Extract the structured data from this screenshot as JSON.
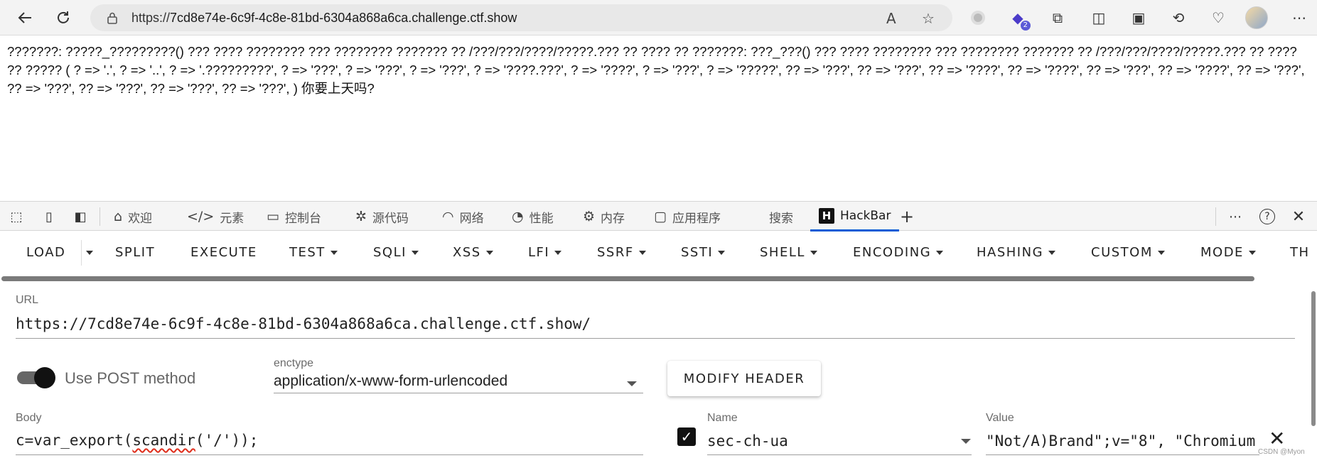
{
  "browser": {
    "url_prefix": "https://",
    "url_host": "7cd8e74e-6c9f-4c8e-81bd-6304a868a6ca.challenge.ctf.show",
    "extension_badge": "2"
  },
  "page": {
    "text": "???????: ?????_?????????() ??? ???? ???????? ??? ???????? ??????? ?? /???/???/????/?????.??? ?? ???? ?? ???????: ???_???() ??? ???? ???????? ??? ???????? ??????? ?? /???/???/????/?????.??? ?? ???? ?? ????? ( ? => '.', ? => '..', ? => '.?????????', ? => '???', ? => '???', ? => '???', ? => '????.???', ? => '????', ? => '???', ? => '?????', ?? => '???', ?? => '???', ?? => '????', ?? => '????', ?? => '???', ?? => '????', ?? => '???', ?? => '???', ?? => '???', ?? => '???', ?? => '???', ) 你要上天吗?"
  },
  "devtools": {
    "tabs": [
      {
        "label": "欢迎",
        "icon": "home-icon"
      },
      {
        "label": "元素",
        "icon": "code-icon"
      },
      {
        "label": "控制台",
        "icon": "console-icon"
      },
      {
        "label": "源代码",
        "icon": "bug-icon"
      },
      {
        "label": "网络",
        "icon": "wifi-icon"
      },
      {
        "label": "性能",
        "icon": "gauge-icon"
      },
      {
        "label": "内存",
        "icon": "chip-icon"
      },
      {
        "label": "应用程序",
        "icon": "app-icon"
      },
      {
        "label": "搜索",
        "icon": ""
      },
      {
        "label": "HackBar",
        "icon": "hackbar-logo-icon"
      }
    ],
    "active_tab": "HackBar"
  },
  "hackbar": {
    "menu": [
      "LOAD",
      "SPLIT",
      "EXECUTE",
      "TEST",
      "SQLI",
      "XSS",
      "LFI",
      "SSRF",
      "SSTI",
      "SHELL",
      "ENCODING",
      "HASHING",
      "CUSTOM",
      "MODE",
      "TH"
    ],
    "url_label": "URL",
    "url_value": "https://7cd8e74e-6c9f-4c8e-81bd-6304a868a6ca.challenge.ctf.show/",
    "post_toggle_label": "Use POST method",
    "post_enabled": true,
    "enctype_label": "enctype",
    "enctype_value": "application/x-www-form-urlencoded",
    "modify_header_label": "MODIFY HEADER",
    "body_label": "Body",
    "body_prefix": "c=var_export(",
    "body_squiggle": "scandir",
    "body_suffix": "('/'));",
    "header_name_label": "Name",
    "header_name_value": "sec-ch-ua",
    "header_value_label": "Value",
    "header_value_value": "\"Not/A)Brand\";v=\"8\", \"Chromium\"",
    "header_checked": true
  },
  "watermark": "CSDN @Myon⁠"
}
